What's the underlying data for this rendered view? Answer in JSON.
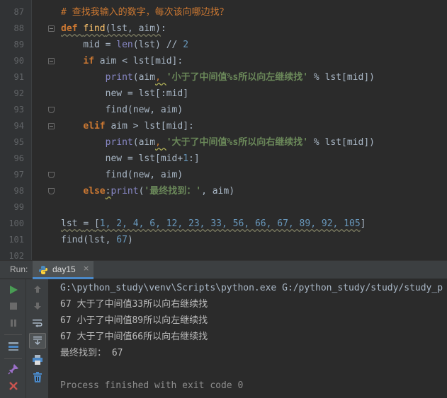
{
  "editor": {
    "line_numbers": [
      "87",
      "88",
      "89",
      "90",
      "91",
      "92",
      "93",
      "94",
      "95",
      "96",
      "97",
      "98",
      "99",
      "100",
      "101",
      "102"
    ],
    "lines": [
      [
        {
          "t": "# 查找我输入的数字，每次该向哪边找？",
          "c": "c-comment"
        }
      ],
      [
        {
          "t": "def ",
          "c": "c-kw wavy-gray"
        },
        {
          "t": "find",
          "c": "c-fn wavy-gray"
        },
        {
          "t": "(lst, aim)",
          "c": "c-plain wavy-gray"
        },
        {
          "t": ":",
          "c": "c-plain"
        }
      ],
      [
        {
          "t": "    mid ",
          "c": "c-plain"
        },
        {
          "t": "= ",
          "c": "c-plain"
        },
        {
          "t": "len",
          "c": "c-builtin"
        },
        {
          "t": "(lst) ",
          "c": "c-plain"
        },
        {
          "t": "// ",
          "c": "c-plain"
        },
        {
          "t": "2",
          "c": "c-num"
        }
      ],
      [
        {
          "t": "    ",
          "c": "c-plain"
        },
        {
          "t": "if ",
          "c": "c-kw"
        },
        {
          "t": "aim < lst[mid]:",
          "c": "c-plain"
        }
      ],
      [
        {
          "t": "        ",
          "c": "c-plain"
        },
        {
          "t": "print",
          "c": "c-builtin"
        },
        {
          "t": "(aim",
          "c": "c-plain"
        },
        {
          "t": ", ",
          "c": "c-op wavy"
        },
        {
          "t": "'小于了中间值%s所以向左继续找' ",
          "c": "c-str"
        },
        {
          "t": "% ",
          "c": "c-plain"
        },
        {
          "t": "lst[mid])",
          "c": "c-plain"
        }
      ],
      [
        {
          "t": "        new ",
          "c": "c-plain"
        },
        {
          "t": "= ",
          "c": "c-plain"
        },
        {
          "t": "lst[:mid]",
          "c": "c-plain"
        }
      ],
      [
        {
          "t": "        find(new, aim)",
          "c": "c-plain"
        }
      ],
      [
        {
          "t": "    ",
          "c": "c-plain"
        },
        {
          "t": "elif ",
          "c": "c-kw"
        },
        {
          "t": "aim > lst[mid]:",
          "c": "c-plain"
        }
      ],
      [
        {
          "t": "        ",
          "c": "c-plain"
        },
        {
          "t": "print",
          "c": "c-builtin"
        },
        {
          "t": "(aim",
          "c": "c-plain"
        },
        {
          "t": ", ",
          "c": "c-op wavy"
        },
        {
          "t": "'大于了中间值%s所以向右继续找' ",
          "c": "c-str"
        },
        {
          "t": "% ",
          "c": "c-plain"
        },
        {
          "t": "lst[mid])",
          "c": "c-plain"
        }
      ],
      [
        {
          "t": "        new ",
          "c": "c-plain"
        },
        {
          "t": "= ",
          "c": "c-plain"
        },
        {
          "t": "lst[mid",
          "c": "c-plain"
        },
        {
          "t": "+",
          "c": "c-plain"
        },
        {
          "t": "1",
          "c": "c-num"
        },
        {
          "t": ":]",
          "c": "c-plain"
        }
      ],
      [
        {
          "t": "        find(new, aim)",
          "c": "c-plain"
        }
      ],
      [
        {
          "t": "    ",
          "c": "c-plain"
        },
        {
          "t": "else",
          "c": "c-kw"
        },
        {
          "t": ":",
          "c": "c-plain wavy"
        },
        {
          "t": "print",
          "c": "c-builtin"
        },
        {
          "t": "(",
          "c": "c-plain"
        },
        {
          "t": "'最终找到：'",
          "c": "c-str"
        },
        {
          "t": ", aim)",
          "c": "c-plain"
        }
      ],
      [],
      [
        {
          "t": "lst ",
          "c": "c-plain wavy-gray"
        },
        {
          "t": "= ",
          "c": "c-plain wavy-gray"
        },
        {
          "t": "[",
          "c": "c-plain wavy-gray"
        },
        {
          "t": "1, 2, 4, 6, 12, 23, 33, 56, 66, 67, 89, 92, 105",
          "c": "c-num wavy-gray"
        },
        {
          "t": "]",
          "c": "c-plain"
        }
      ],
      [
        {
          "t": "find(lst, ",
          "c": "c-plain"
        },
        {
          "t": "67",
          "c": "c-num"
        },
        {
          "t": ")",
          "c": "c-plain"
        }
      ],
      []
    ]
  },
  "run_panel": {
    "label": "Run:",
    "tab_label": "day15",
    "tab_close": "×",
    "console_lines": [
      {
        "text": "G:\\python_study\\venv\\Scripts\\python.exe G:/python_study/study/study_p",
        "kind": "path"
      },
      {
        "text": "67 大于了中间值33所以向右继续找",
        "kind": "out"
      },
      {
        "text": "67 小于了中间值89所以向左继续找",
        "kind": "out"
      },
      {
        "text": "67 大于了中间值66所以向右继续找",
        "kind": "out"
      },
      {
        "text": "最终找到： 67",
        "kind": "out"
      },
      {
        "text": "",
        "kind": "out"
      },
      {
        "text": "Process finished with exit code 0",
        "kind": "gray"
      }
    ]
  },
  "icons": {
    "run": "run-icon",
    "stop": "stop-icon",
    "pause": "pause-icon",
    "dump": "dump-threads-icon",
    "pin": "pin-icon",
    "close": "close-icon",
    "up": "up-arrow-icon",
    "down": "down-arrow-icon",
    "wrap": "soft-wrap-icon",
    "scroll_end": "scroll-to-end-icon",
    "print": "print-icon",
    "trash": "trash-icon"
  },
  "colors": {
    "run_green": "#499c54",
    "stop_red": "#c75450",
    "accent_blue": "#4a88c7"
  }
}
